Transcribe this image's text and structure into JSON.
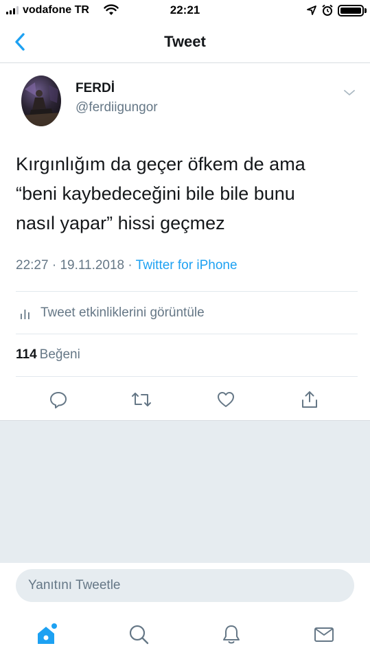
{
  "status_bar": {
    "carrier": "vodafone TR",
    "time": "22:21",
    "icons": [
      "signal-icon",
      "wifi-icon",
      "location-icon",
      "alarm-icon",
      "battery-icon"
    ]
  },
  "nav": {
    "title": "Tweet",
    "back_icon": "chevron-left-icon"
  },
  "tweet": {
    "display_name": "FERDİ",
    "handle": "@ferdiigungor",
    "text": "Kırgınlığım da geçer öfkem de ama\n“beni kaybedeceğini bile bile bunu\nnasıl yapar” hissi geçmez",
    "time": "22:27",
    "separator": "·",
    "date": "19.11.2018",
    "source": "Twitter for iPhone"
  },
  "activity": {
    "label": "Tweet etkinliklerini görüntüle",
    "icon": "bar-chart-icon"
  },
  "likes": {
    "count": "114",
    "label": "Beğeni"
  },
  "actions": [
    "reply-icon",
    "retweet-icon",
    "like-icon",
    "share-icon"
  ],
  "reply": {
    "placeholder": "Yanıtını Tweetle"
  },
  "tabs": [
    "home-icon",
    "search-icon",
    "notifications-icon",
    "messages-icon"
  ],
  "colors": {
    "accent": "#1da1f2",
    "text": "#14171a",
    "secondary_text": "#657786",
    "divider": "#e1e8ed",
    "background_gray": "#e6ecf0"
  }
}
